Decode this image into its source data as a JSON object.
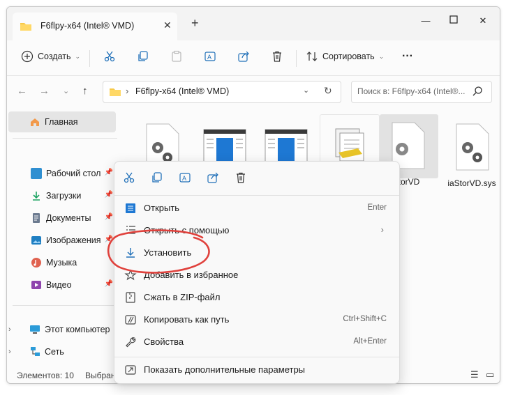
{
  "window": {
    "tab_title": "F6flpy-x64 (Intel® VMD)",
    "tab_close": "✕",
    "new_tab": "+"
  },
  "toolbar": {
    "new_label": "Создать",
    "sort_label": "Сортировать",
    "more": "···"
  },
  "address": {
    "path": "F6flpy-x64 (Intel® VMD)",
    "search_placeholder": "Поиск в: F6flpy-x64 (Intel®..."
  },
  "sidebar": {
    "home": "Главная",
    "quick": [
      {
        "label": "Рабочий стол",
        "color": "#2f8fd1"
      },
      {
        "label": "Загрузки",
        "color": "#1aa260"
      },
      {
        "label": "Документы",
        "color": "#6b7a8f"
      },
      {
        "label": "Изображения",
        "color": "#1f7fc2"
      },
      {
        "label": "Музыка",
        "color": "#e0624f"
      },
      {
        "label": "Видео",
        "color": "#8e44ad"
      }
    ],
    "this_pc": "Этот компьютер",
    "network": "Сеть"
  },
  "files": [
    {
      "label": ""
    },
    {
      "label": ""
    },
    {
      "label": ""
    },
    {
      "label": ""
    },
    {
      "label": "torVD"
    },
    {
      "label": "iaStorVD.sys"
    }
  ],
  "status": {
    "count": "Элементов: 10",
    "selected": "Выбран"
  },
  "context_menu": {
    "items": [
      {
        "label": "Открыть",
        "shortcut": "Enter"
      },
      {
        "label": "Открыть с помощью",
        "shortcut": "›"
      },
      {
        "label": "Установить",
        "shortcut": ""
      },
      {
        "label": "Добавить в избранное",
        "shortcut": ""
      },
      {
        "label": "Сжать в ZIP-файл",
        "shortcut": ""
      },
      {
        "label": "Копировать как путь",
        "shortcut": "Ctrl+Shift+C"
      },
      {
        "label": "Свойства",
        "shortcut": "Alt+Enter"
      },
      {
        "label": "Показать дополнительные параметры",
        "shortcut": ""
      }
    ]
  },
  "colors": {
    "accent": "#0067c0",
    "highlight_circle": "#e0413c"
  }
}
